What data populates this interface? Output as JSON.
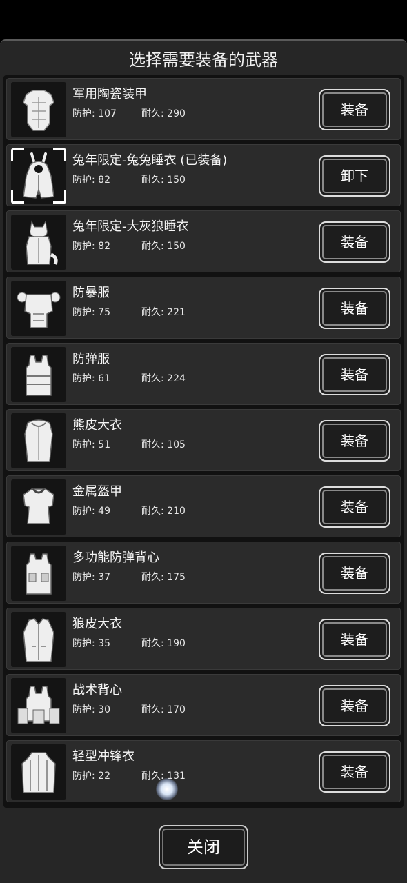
{
  "title": "选择需要装备的武器",
  "stat_labels": {
    "protection": "防护",
    "durability": "耐久"
  },
  "items": [
    {
      "name": "军用陶瓷装甲",
      "protection_text": "防护: 107",
      "durability_text": "耐久: 290",
      "button": "装备",
      "icon": "ceramic-armor-icon"
    },
    {
      "name": "兔年限定-兔兔睡衣 (已装备)",
      "protection_text": "防护: 82",
      "durability_text": "耐久: 150",
      "button": "卸下",
      "icon": "bunny-pajamas-icon",
      "selected": true
    },
    {
      "name": "兔年限定-大灰狼睡衣",
      "protection_text": "防护: 82",
      "durability_text": "耐久: 150",
      "button": "装备",
      "icon": "wolf-pajamas-icon"
    },
    {
      "name": "防暴服",
      "protection_text": "防护: 75",
      "durability_text": "耐久: 221",
      "button": "装备",
      "icon": "riot-suit-icon"
    },
    {
      "name": "防弹服",
      "protection_text": "防护: 61",
      "durability_text": "耐久: 224",
      "button": "装备",
      "icon": "bulletproof-vest-icon"
    },
    {
      "name": "熊皮大衣",
      "protection_text": "防护: 51",
      "durability_text": "耐久: 105",
      "button": "装备",
      "icon": "bearskin-coat-icon"
    },
    {
      "name": "金属盔甲",
      "protection_text": "防护: 49",
      "durability_text": "耐久: 210",
      "button": "装备",
      "icon": "metal-armor-icon"
    },
    {
      "name": "多功能防弹背心",
      "protection_text": "防护: 37",
      "durability_text": "耐久: 175",
      "button": "装备",
      "icon": "multi-vest-icon"
    },
    {
      "name": "狼皮大衣",
      "protection_text": "防护: 35",
      "durability_text": "耐久: 190",
      "button": "装备",
      "icon": "wolfskin-coat-icon"
    },
    {
      "name": "战术背心",
      "protection_text": "防护: 30",
      "durability_text": "耐久: 170",
      "button": "装备",
      "icon": "tactical-vest-icon"
    },
    {
      "name": "轻型冲锋衣",
      "protection_text": "防护: 22",
      "durability_text": "耐久: 131",
      "button": "装备",
      "icon": "light-jacket-icon"
    }
  ],
  "close_button": "关闭"
}
